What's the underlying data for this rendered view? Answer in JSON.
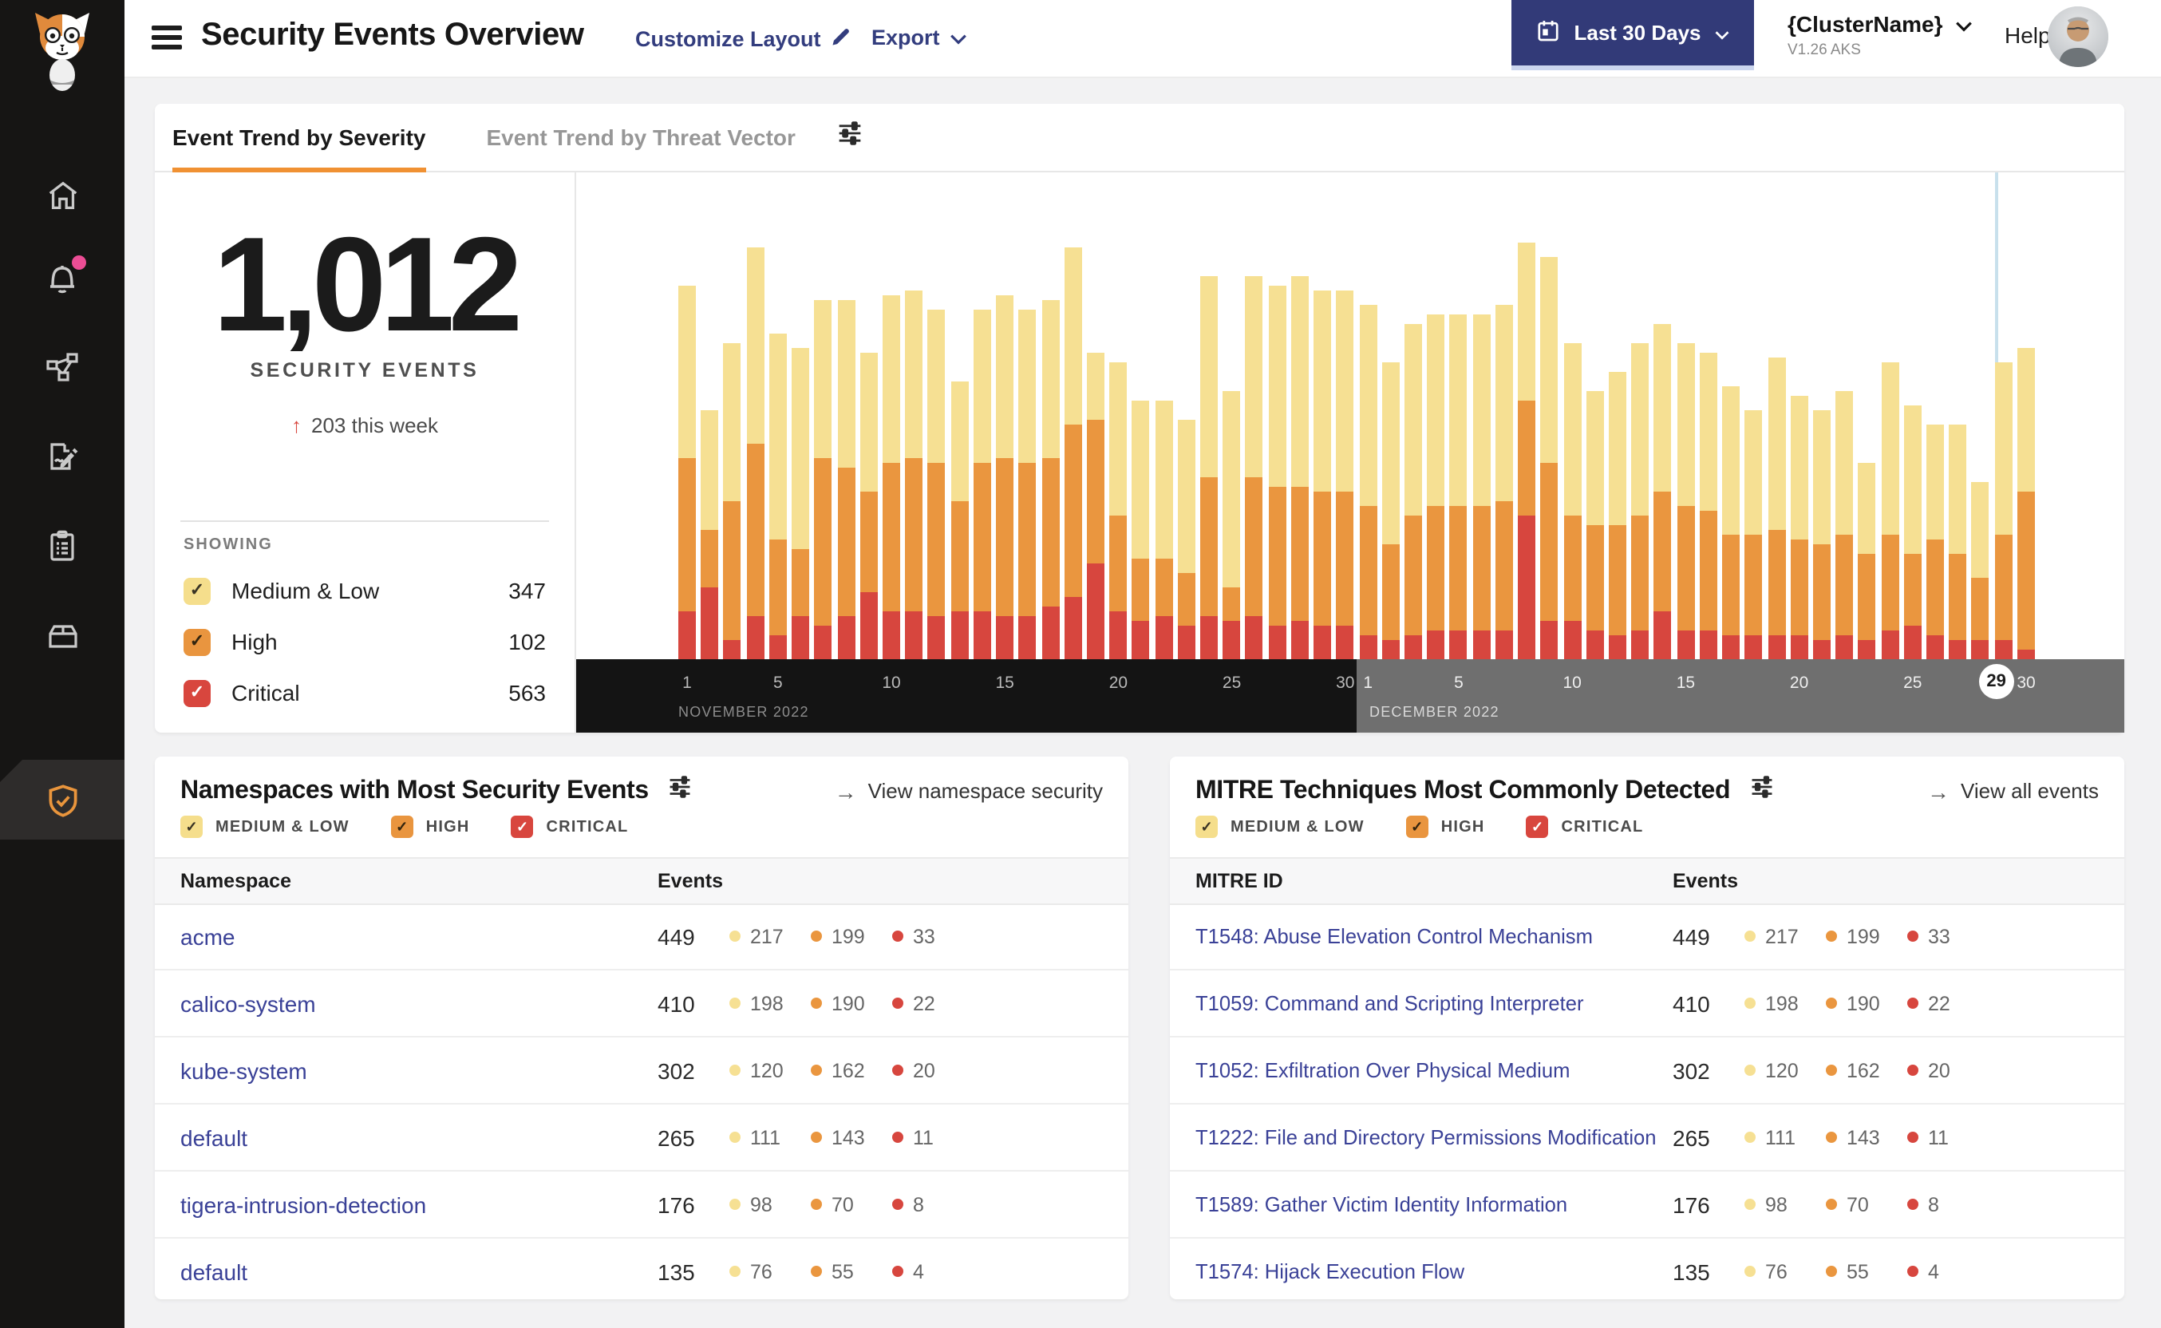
{
  "page": {
    "background": "#F2F2F3"
  },
  "header": {
    "title": "Security Events Overview",
    "customize_label": "Customize Layout",
    "export_label": "Export",
    "date_range_label": "Last 30 Days",
    "cluster_name": "{ClusterName}",
    "cluster_version": "V1.26 AKS",
    "help_label": "Help"
  },
  "sidebar": {
    "items": [
      {
        "name": "logo",
        "icon": "cat-logo-icon"
      },
      {
        "name": "home",
        "icon": "home-icon"
      },
      {
        "name": "alerts",
        "icon": "bell-icon",
        "badge": true
      },
      {
        "name": "service-graph",
        "icon": "network-graph-icon"
      },
      {
        "name": "reports",
        "icon": "report-edit-icon"
      },
      {
        "name": "compliance",
        "icon": "clipboard-icon"
      },
      {
        "name": "workloads",
        "icon": "storage-box-icon"
      },
      {
        "name": "security-events",
        "icon": "shield-check-icon",
        "active": true
      }
    ]
  },
  "severities": [
    {
      "key": "medium",
      "label": "Medium & Low",
      "filter_label": "MEDIUM & LOW",
      "color": "#F5DE8C",
      "bar_color": "#F6E093",
      "check_color": "#3A3425",
      "count": 347
    },
    {
      "key": "high",
      "label": "High",
      "filter_label": "HIGH",
      "color": "#E9953F",
      "bar_color": "#EA963F",
      "check_color": "#33250F",
      "count": 102
    },
    {
      "key": "critical",
      "label": "Critical",
      "filter_label": "CRITICAL",
      "color": "#D8463E",
      "bar_color": "#D7463E",
      "check_color": "#FFFFFF",
      "count": 563
    }
  ],
  "trend_card": {
    "tabs": [
      {
        "label": "Event Trend by Severity",
        "active": true
      },
      {
        "label": "Event Trend by Threat Vector",
        "active": false
      }
    ],
    "total": "1,012",
    "total_label": "SECURITY EVENTS",
    "delta_arrow": "↑",
    "delta": "203 this week",
    "showing_label": "SHOWING"
  },
  "chart_data": {
    "type": "bar",
    "stacked": true,
    "ylim": [
      0,
      100
    ],
    "grid": false,
    "legend_position": "left-panel",
    "months": [
      {
        "label": "NOVEMBER 2022",
        "days": 30,
        "ticks": [
          1,
          5,
          10,
          15,
          20,
          25,
          30
        ]
      },
      {
        "label": "DECEMBER 2022",
        "days": 30,
        "ticks": [
          1,
          5,
          10,
          15,
          20,
          25,
          30
        ]
      }
    ],
    "selected": {
      "month_index": 1,
      "day": 29
    },
    "series": [
      {
        "name": "Critical",
        "color": "#D7463E",
        "values": [
          10,
          15,
          4,
          9,
          5,
          9,
          7,
          9,
          14,
          10,
          10,
          9,
          10,
          10,
          9,
          9,
          11,
          13,
          20,
          10,
          8,
          9,
          7,
          9,
          8,
          9,
          7,
          8,
          7,
          7,
          5,
          4,
          5,
          6,
          6,
          6,
          6,
          30,
          8,
          8,
          6,
          5,
          6,
          10,
          6,
          6,
          5,
          5,
          5,
          5,
          4,
          5,
          4,
          6,
          7,
          5,
          4,
          4,
          4,
          2
        ]
      },
      {
        "name": "High",
        "color": "#EA963F",
        "values": [
          32,
          12,
          29,
          36,
          20,
          14,
          35,
          31,
          21,
          31,
          32,
          32,
          23,
          31,
          33,
          32,
          31,
          36,
          30,
          20,
          13,
          12,
          11,
          29,
          7,
          29,
          29,
          28,
          28,
          28,
          27,
          20,
          25,
          26,
          26,
          26,
          27,
          24,
          33,
          22,
          22,
          23,
          24,
          25,
          26,
          25,
          21,
          21,
          22,
          20,
          20,
          21,
          18,
          20,
          15,
          20,
          18,
          13,
          22,
          33
        ]
      },
      {
        "name": "Medium & Low",
        "color": "#F6E093",
        "values": [
          36,
          25,
          33,
          41,
          43,
          42,
          33,
          35,
          29,
          35,
          35,
          32,
          25,
          32,
          34,
          32,
          33,
          37,
          14,
          32,
          33,
          33,
          32,
          42,
          41,
          42,
          42,
          44,
          42,
          42,
          42,
          38,
          40,
          40,
          40,
          40,
          41,
          33,
          43,
          36,
          28,
          32,
          36,
          35,
          34,
          33,
          31,
          26,
          36,
          30,
          28,
          30,
          19,
          36,
          31,
          24,
          27,
          20,
          36,
          30
        ]
      }
    ]
  },
  "namespaces_card": {
    "title": "Namespaces with Most Security Events",
    "link_arrow": "→",
    "link": "View namespace security",
    "columns": [
      "Namespace",
      "Events"
    ],
    "rows": [
      {
        "name": "acme",
        "total": 449,
        "medium": 217,
        "high": 199,
        "critical": 33
      },
      {
        "name": "calico-system",
        "total": 410,
        "medium": 198,
        "high": 190,
        "critical": 22
      },
      {
        "name": "kube-system",
        "total": 302,
        "medium": 120,
        "high": 162,
        "critical": 20
      },
      {
        "name": "default",
        "total": 265,
        "medium": 111,
        "high": 143,
        "critical": 11
      },
      {
        "name": "tigera-intrusion-detection",
        "total": 176,
        "medium": 98,
        "high": 70,
        "critical": 8
      },
      {
        "name": "default",
        "total": 135,
        "medium": 76,
        "high": 55,
        "critical": 4
      }
    ]
  },
  "mitre_card": {
    "title": "MITRE Techniques Most Commonly Detected",
    "link_arrow": "→",
    "link": "View all events",
    "columns": [
      "MITRE ID",
      "Events"
    ],
    "rows": [
      {
        "name": "T1548: Abuse Elevation Control Mechanism",
        "total": 449,
        "medium": 217,
        "high": 199,
        "critical": 33
      },
      {
        "name": "T1059: Command and Scripting Interpreter",
        "total": 410,
        "medium": 198,
        "high": 190,
        "critical": 22
      },
      {
        "name": "T1052: Exfiltration Over Physical Medium",
        "total": 302,
        "medium": 120,
        "high": 162,
        "critical": 20
      },
      {
        "name": "T1222: File and Directory Permissions Modification",
        "total": 265,
        "medium": 111,
        "high": 143,
        "critical": 11
      },
      {
        "name": "T1589: Gather Victim Identity Information",
        "total": 176,
        "medium": 98,
        "high": 70,
        "critical": 8
      },
      {
        "name": "T1574: Hijack Execution Flow",
        "total": 135,
        "medium": 76,
        "high": 55,
        "critical": 4
      }
    ]
  }
}
